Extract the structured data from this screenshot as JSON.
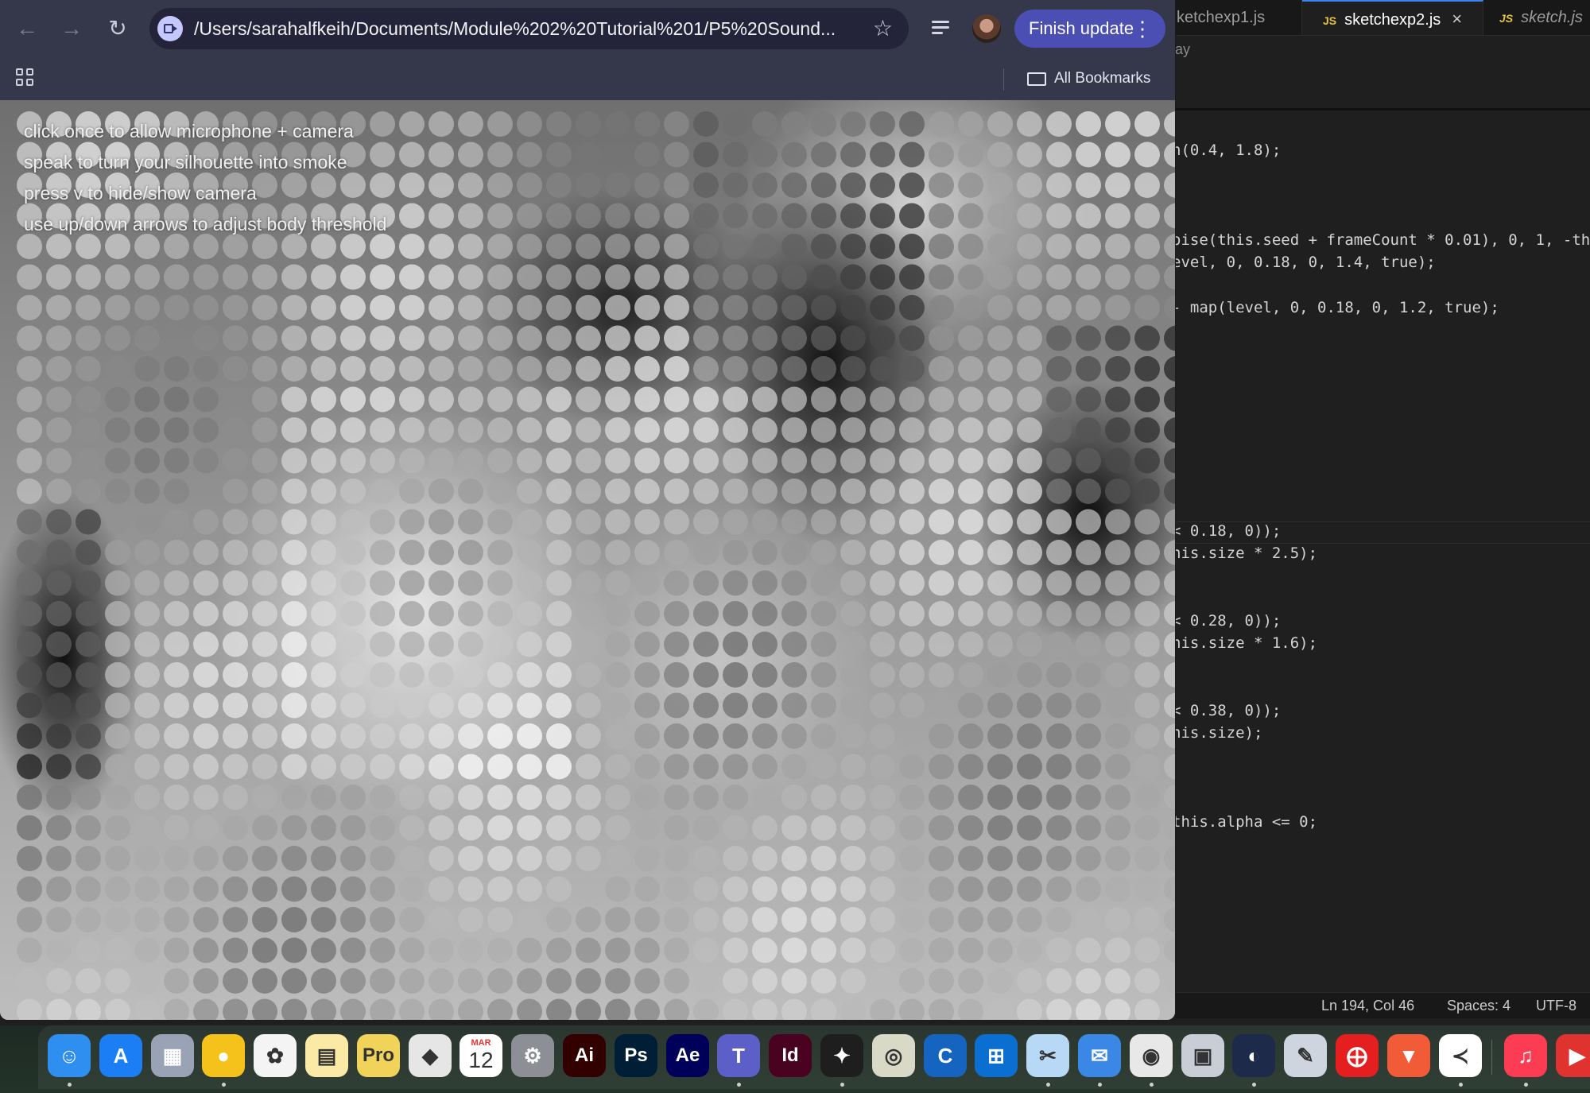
{
  "editor": {
    "tabs": [
      {
        "label": "ketchexp1.js",
        "active": false,
        "js_badge": ""
      },
      {
        "label": "sketchexp2.js",
        "active": true,
        "js_badge": "JS"
      },
      {
        "label": "sketch.js",
        "active": false,
        "js_badge": "JS"
      }
    ],
    "breadcrumb_fragment": "ay",
    "code_lines": [
      "n(0.4, 1.8);",
      "oise(this.seed + frameCount * 0.01), 0, 1, -thi",
      "evel, 0, 0.18, 0, 1.4, true);",
      "- map(level, 0, 0.18, 0, 1.2, true);",
      "< 0.18, 0));",
      "his.size * 2.5);",
      "< 0.28, 0));",
      "his.size * 1.6);",
      "< 0.38, 0));",
      "his.size);",
      "this.alpha <= 0;"
    ],
    "status": {
      "position": "Ln 194, Col 46",
      "spaces": "Spaces: 4",
      "encoding": "UTF-8"
    }
  },
  "browser": {
    "url": "/Users/sarahalfkeih/Documents/Module%202%20Tutorial%201/P5%20Sound...",
    "finish_update_label": "Finish update",
    "all_bookmarks_label": "All Bookmarks",
    "icons": {
      "back": "arrow-left-icon",
      "forward": "arrow-right-icon",
      "reload": "reload-icon",
      "bookmark": "star-icon",
      "more": "kebab-menu-icon"
    }
  },
  "canvas": {
    "hints": [
      "click once to allow microphone + camera",
      "speak to turn your silhouette into smoke",
      "press v to hide/show camera",
      "use up/down arrows to adjust body threshold"
    ]
  },
  "dock": {
    "calendar": {
      "month": "MAR",
      "day": "12"
    },
    "apps": [
      {
        "name": "finder-icon",
        "color": "#2f8ff0",
        "glyph": "☺",
        "running": true
      },
      {
        "name": "app-store-icon",
        "color": "#1c7ef5",
        "glyph": "A",
        "running": false
      },
      {
        "name": "launchpad-icon",
        "color": "#9aa3b5",
        "glyph": "▦",
        "running": false
      },
      {
        "name": "cyberduck-icon",
        "color": "#f5c21b",
        "glyph": "●",
        "running": true
      },
      {
        "name": "photos-icon",
        "color": "#f4f4f4",
        "glyph": "✿",
        "running": false
      },
      {
        "name": "notes-icon",
        "color": "#fbe9a6",
        "glyph": "▤",
        "running": false
      },
      {
        "name": "stickies-icon",
        "color": "#f2d35a",
        "glyph": "Pro",
        "running": false
      },
      {
        "name": "roblox-icon",
        "color": "#e6e6e6",
        "glyph": "◆",
        "running": false
      },
      {
        "name": "calendar-icon",
        "color": "#ffffff",
        "glyph": "",
        "running": false
      },
      {
        "name": "system-settings-icon",
        "color": "#8d8f96",
        "glyph": "⚙",
        "running": false
      },
      {
        "name": "illustrator-icon",
        "color": "#330000",
        "glyph": "Ai",
        "running": false
      },
      {
        "name": "photoshop-icon",
        "color": "#001e36",
        "glyph": "Ps",
        "running": false
      },
      {
        "name": "after-effects-icon",
        "color": "#00005b",
        "glyph": "Ae",
        "running": false
      },
      {
        "name": "teams-icon",
        "color": "#5b5fc7",
        "glyph": "T",
        "running": true
      },
      {
        "name": "indesign-icon",
        "color": "#49021f",
        "glyph": "Id",
        "running": false
      },
      {
        "name": "figma-icon",
        "color": "#1e1e1e",
        "glyph": "✦",
        "running": true
      },
      {
        "name": "screen-capture-icon",
        "color": "#d9d9c8",
        "glyph": "◎",
        "running": false
      },
      {
        "name": "canva-icon",
        "color": "#1565c0",
        "glyph": "C",
        "running": false
      },
      {
        "name": "window-manager-icon",
        "color": "#0b6fd1",
        "glyph": "⊞",
        "running": false
      },
      {
        "name": "scissors-icon",
        "color": "#b7d9f5",
        "glyph": "✂",
        "running": true
      },
      {
        "name": "mail-sender-icon",
        "color": "#3a87e6",
        "glyph": "✉",
        "running": true
      },
      {
        "name": "chrome-icon",
        "color": "#e8e8e8",
        "glyph": "◉",
        "running": true
      },
      {
        "name": "preview-icon",
        "color": "#c8cdd6",
        "glyph": "▣",
        "running": false
      },
      {
        "name": "cinema4d-icon",
        "color": "#1d2a4a",
        "glyph": "◐",
        "running": true
      },
      {
        "name": "pencil-app-icon",
        "color": "#cfd5de",
        "glyph": "✎",
        "running": false
      },
      {
        "name": "acrobat-icon",
        "color": "#e51f1f",
        "glyph": "⨁",
        "running": false
      },
      {
        "name": "brave-icon",
        "color": "#f25b38",
        "glyph": "▼",
        "running": false
      },
      {
        "name": "vscode-icon",
        "color": "#ffffff",
        "glyph": "≺",
        "running": true
      },
      {
        "name": "music-icon",
        "color": "#fb3c52",
        "glyph": "♫",
        "running": true
      },
      {
        "name": "app-partial-icon",
        "color": "#e0322f",
        "glyph": "▶",
        "running": false
      }
    ]
  }
}
